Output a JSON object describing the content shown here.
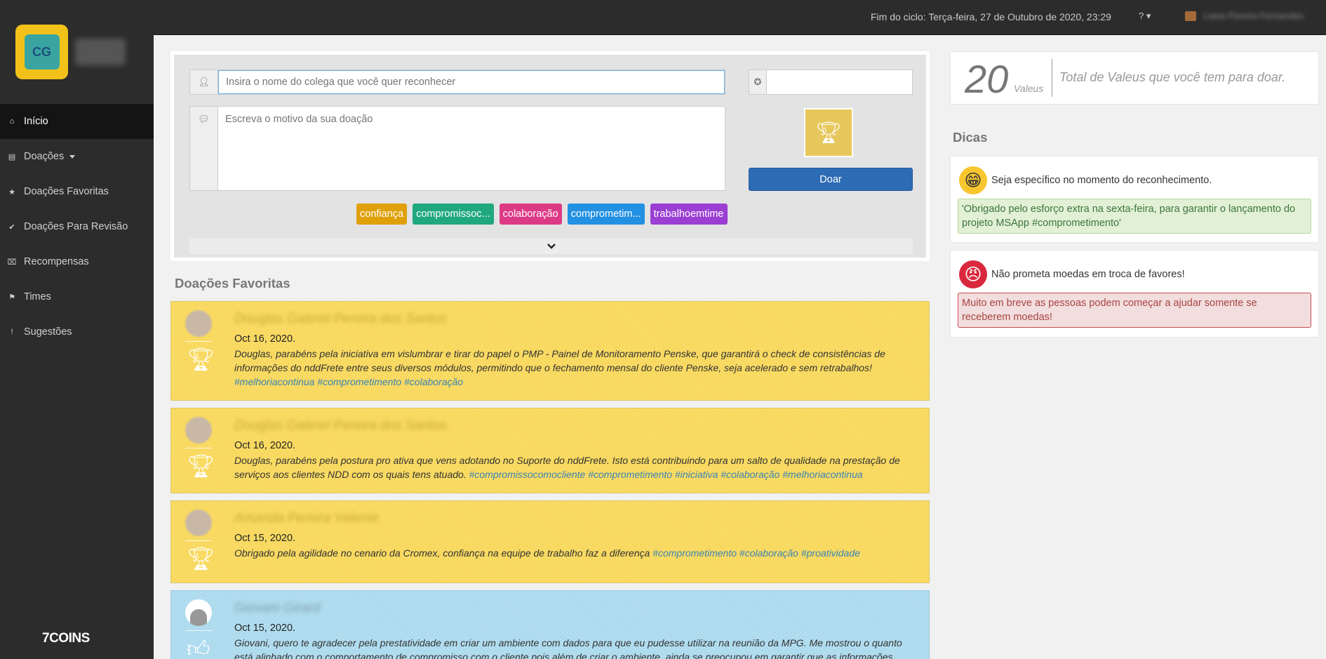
{
  "sidebar": {
    "logo_text": "CG",
    "items": [
      {
        "label": "Início",
        "icon": "home-icon",
        "glyph": "⌂"
      },
      {
        "label": "Doações",
        "icon": "document-icon",
        "glyph": "▤"
      },
      {
        "label": "Doações Favoritas",
        "icon": "star-icon",
        "glyph": "★"
      },
      {
        "label": "Doações Para Revisão",
        "icon": "check-circle-icon",
        "glyph": "✔"
      },
      {
        "label": "Recompensas",
        "icon": "gift-icon",
        "glyph": "⌧"
      },
      {
        "label": "Times",
        "icon": "flag-icon",
        "glyph": "⚑"
      },
      {
        "label": "Sugestões",
        "icon": "exclamation-icon",
        "glyph": "!"
      }
    ],
    "footer_brand": "7COINS"
  },
  "topbar": {
    "cycle_end": "Fim do ciclo: Terça-feira, 27 de Outubro de 2020, 23:29",
    "help_glyph": "? ▾",
    "user_name": "Liana Pereira Fernandes"
  },
  "donate": {
    "name_placeholder": "Insira o nome do colega que você quer reconhecer",
    "reason_placeholder": "Escreva o motivo da sua doação",
    "value": "",
    "button_label": "Doar",
    "tags": [
      {
        "label": "confiança",
        "color": "#e0a00a"
      },
      {
        "label": "compromissoc...",
        "color": "#1fa87e"
      },
      {
        "label": "colaboração",
        "color": "#dd3a86"
      },
      {
        "label": "comprometim...",
        "color": "#2290e3"
      },
      {
        "label": "trabalhoemtime",
        "color": "#9b3fd3"
      }
    ]
  },
  "favorites": {
    "title": "Doações Favoritas",
    "items": [
      {
        "name": "Douglas Gabriel Pereira dos Santos",
        "date": "Oct 16, 2020.",
        "text": "Douglas, parabéns pela iniciativa em vislumbrar e tirar do papel o PMP - Painel de Monitoramento Penske, que garantirá o check de consistências de informações do nddFrete entre seus diversos módulos, permitindo que o fechamento mensal do cliente Penske, seja acelerado e sem retrabalhos!",
        "hashtags": "#melhoriacontinua #comprometimento #colaboração"
      },
      {
        "name": "Douglas Gabriel Pereira dos Santos",
        "date": "Oct 16, 2020.",
        "text": "Douglas, parabéns pela postura pro ativa que vens adotando no Suporte do nddFrete. Isto está contribuindo para um salto de qualidade na prestação de serviços aos clientes NDD com os quais tens atuado.",
        "hashtags": "#compromissocomocliente #comprometimento #iniciativa #colaboração #melhoriacontinua"
      },
      {
        "name": "Amanda Pereira Valente",
        "date": "Oct 15, 2020.",
        "text": "Obrigado pela agilidade no cenario da Cromex, confiança na equipe de trabalho faz a diferença",
        "hashtags": "#comprometimento #colaboração #proatividade"
      },
      {
        "name": "Giovani Girard",
        "date": "Oct 15, 2020.",
        "text": "Giovani, quero te agradecer pela prestatividade em criar um ambiente com dados para que eu pudesse utilizar na reunião da MPG. Me mostrou o quanto está alinhado com o comportamento de compromisso com o cliente pois além de criar o ambiente, ainda se preocupou em garantir que as informações eram",
        "hashtags": ""
      }
    ]
  },
  "balance": {
    "amount": "20",
    "unit": "Valeus",
    "description": "Total de Valeus que você tem para doar."
  },
  "tips": {
    "title": "Dicas",
    "items": [
      {
        "heading": "Seja específico no momento do reconhecimento.",
        "emoji": "😁",
        "example": "'Obrigado pelo esforço extra na sexta-feira, para garantir o lançamento do projeto MSApp #comprometimento'"
      },
      {
        "heading": "Não prometa moedas em troca de favores!",
        "emoji": "😠",
        "example": "Muito em breve as pessoas podem começar a ajudar somente se receberem moedas!"
      }
    ]
  }
}
